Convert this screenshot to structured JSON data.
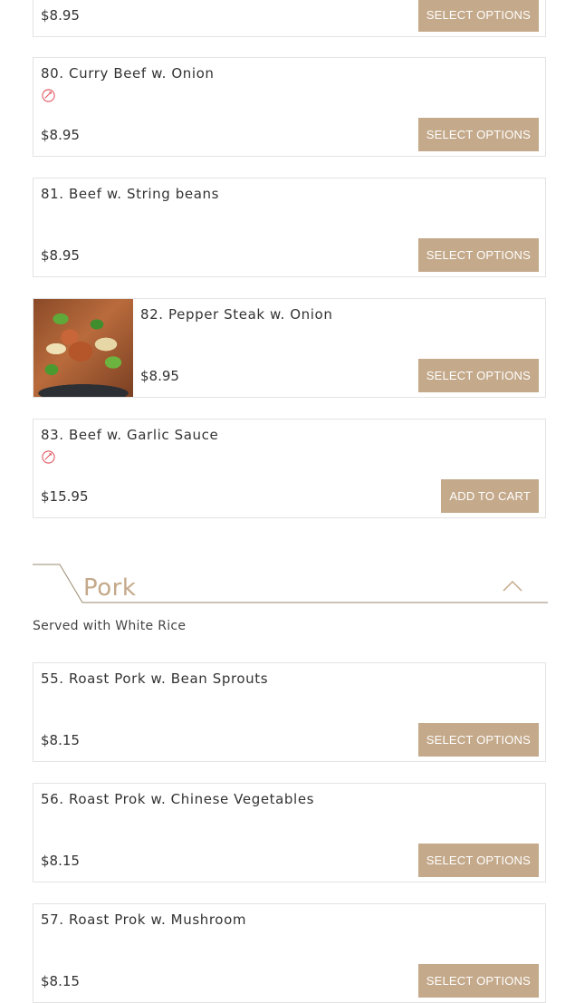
{
  "items_beef": [
    {
      "name": "",
      "price": "$8.95",
      "button": "SELECT OPTIONS",
      "spicy": false,
      "image": false
    },
    {
      "name": "80. Curry Beef w. Onion",
      "price": "$8.95",
      "button": "SELECT OPTIONS",
      "spicy": true,
      "image": false
    },
    {
      "name": "81. Beef w. String beans",
      "price": "$8.95",
      "button": "SELECT OPTIONS",
      "spicy": false,
      "image": false
    },
    {
      "name": "82. Pepper Steak w. Onion",
      "price": "$8.95",
      "button": "SELECT OPTIONS",
      "spicy": false,
      "image": true
    },
    {
      "name": "83. Beef w. Garlic Sauce",
      "price": "$15.95",
      "button": "ADD TO CART",
      "spicy": true,
      "image": false
    }
  ],
  "pork_section": {
    "title": "Pork",
    "description": "Served with White Rice",
    "toggle_icon": "chevron-up-icon"
  },
  "items_pork": [
    {
      "name": "55. Roast Pork w. Bean Sprouts",
      "price": "$8.15",
      "button": "SELECT OPTIONS"
    },
    {
      "name": "56. Roast Prok w. Chinese Vegetables",
      "price": "$8.15",
      "button": "SELECT OPTIONS"
    },
    {
      "name": "57. Roast Prok w. Mushroom",
      "price": "$8.15",
      "button": "SELECT OPTIONS"
    }
  ],
  "colors": {
    "accent": "#c4a98a",
    "spicy": "#e0505a",
    "border": "#e3e3e3"
  }
}
